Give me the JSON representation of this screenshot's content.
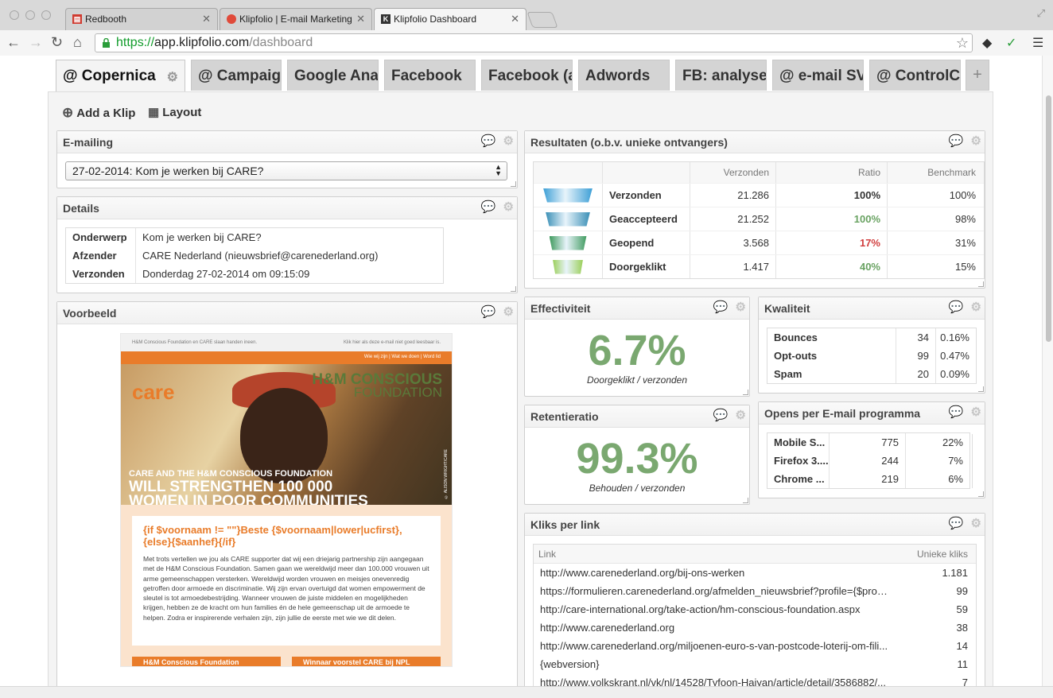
{
  "browser": {
    "tabs": [
      {
        "title": "Redbooth"
      },
      {
        "title": "Klipfolio | E-mail Marketing"
      },
      {
        "title": "Klipfolio Dashboard"
      }
    ],
    "url_scheme": "https://",
    "url_host": "app.klipfolio.com",
    "url_path": "/dashboard"
  },
  "dashboard": {
    "tabs": [
      {
        "label": "@ Copernica"
      },
      {
        "label": "@ Campaign"
      },
      {
        "label": "Google Analytics"
      },
      {
        "label": "Facebook"
      },
      {
        "label": "Facebook (a"
      },
      {
        "label": "Adwords"
      },
      {
        "label": "FB: analyse"
      },
      {
        "label": "@ e-mail SV"
      },
      {
        "label": "@ ControlC"
      }
    ],
    "plus": "+",
    "add_klip": "Add a Klip",
    "layout": "Layout"
  },
  "emailing": {
    "title": "E-mailing",
    "selected": "27-02-2014: Kom je werken bij CARE?"
  },
  "details": {
    "title": "Details",
    "rows": [
      {
        "label": "Onderwerp",
        "value": "Kom je werken bij CARE?"
      },
      {
        "label": "Afzender",
        "value": "CARE Nederland (nieuwsbrief@carenederland.org)"
      },
      {
        "label": "Verzonden",
        "value": "Donderdag 27-02-2014 om 09:15:09"
      }
    ]
  },
  "voorbeeld": {
    "title": "Voorbeeld",
    "top_left": "H&M Conscious Foundation en CARE slaan handen ineen.",
    "top_right": "Klik hier als deze e-mail niet goed leesbaar is.",
    "nav": "Wie wij zijn | Wat we doen | Word lid",
    "logo_care": "care",
    "logo_hm": "H&M CONSCIOUS",
    "logo_hm2": "FOUNDATION",
    "hero_line1": "CARE AND THE H&M CONSCIOUS FOUNDATION",
    "hero_line2": "WILL STRENGTHEN 100 000",
    "hero_line3": "WOMEN IN POOR COMMUNITIES",
    "credit": "© ALISON WRIGHT/CARE",
    "greeting": "{if $voornaam != \"\"}Beste {$voornaam|lower|ucfirst}, {else}{$aanhef}{/if}",
    "body": "Met trots vertellen we jou als CARE supporter dat wij een driejarig partnership zijn aangegaan met de H&M Conscious Foundation. Samen gaan we wereldwijd meer dan 100.000 vrouwen uit arme gemeenschappen versterken. Wereldwijd worden vrouwen en meisjes onevenredig getroffen door armoede en discriminatie. Wij zijn ervan overtuigd dat women empowerment de sleutel is tot armoedebestrijding. Wanneer vrouwen de juiste middelen en mogelijkheden krijgen, hebben ze de kracht om hun families én de hele gemeenschap uit de armoede te helpen. Zodra er inspirerende verhalen zijn, zijn jullie de eerste met wie we dit delen.",
    "btn1": "H&M Conscious Foundation",
    "btn2": "Winnaar voorstel CARE bij NPL"
  },
  "resultaten": {
    "title": "Resultaten (o.b.v. unieke ontvangers)",
    "headers": [
      "Verzonden",
      "Ratio",
      "Benchmark"
    ],
    "rows": [
      {
        "label": "Verzonden",
        "value": "21.286",
        "ratio": "100%",
        "benchmark": "100%",
        "ratio_color": "#333333",
        "funnel": "#3d9fd6",
        "funnel_pct": 100
      },
      {
        "label": "Geaccepteerd",
        "value": "21.252",
        "ratio": "100%",
        "benchmark": "98%",
        "ratio_color": "#6aa363",
        "funnel": "#3a8fb6",
        "funnel_pct": 90
      },
      {
        "label": "Geopend",
        "value": "3.568",
        "ratio": "17%",
        "benchmark": "31%",
        "ratio_color": "#d13f3f",
        "funnel": "#3f9a5e",
        "funnel_pct": 75
      },
      {
        "label": "Doorgeklikt",
        "value": "1.417",
        "ratio": "40%",
        "benchmark": "15%",
        "ratio_color": "#6aa363",
        "funnel": "#9bcf5a",
        "funnel_pct": 62
      }
    ]
  },
  "effectiviteit": {
    "title": "Effectiviteit",
    "value": "6.7%",
    "sub": "Doorgeklikt / verzonden"
  },
  "retentie": {
    "title": "Retentieratio",
    "value": "99.3%",
    "sub": "Behouden / verzonden"
  },
  "kwaliteit": {
    "title": "Kwaliteit",
    "rows": [
      {
        "label": "Bounces",
        "count": "34",
        "pct": "0.16%"
      },
      {
        "label": "Opt-outs",
        "count": "99",
        "pct": "0.47%"
      },
      {
        "label": "Spam",
        "count": "20",
        "pct": "0.09%"
      }
    ]
  },
  "opens": {
    "title": "Opens per E-mail programma",
    "rows": [
      {
        "label": "Mobile S...",
        "count": "775",
        "pct": "22%"
      },
      {
        "label": "Firefox 3....",
        "count": "244",
        "pct": "7%"
      },
      {
        "label": "Chrome ...",
        "count": "219",
        "pct": "6%"
      }
    ]
  },
  "kliks": {
    "title": "Kliks per link",
    "headers": [
      "Link",
      "Unieke kliks"
    ],
    "rows": [
      {
        "link": "http://www.carenederland.org/bij-ons-werken",
        "count": "1.181"
      },
      {
        "link": "https://formulieren.carenederland.org/afmelden_nieuwsbrief?profile={$prof...",
        "count": "99"
      },
      {
        "link": "http://care-international.org/take-action/hm-conscious-foundation.aspx",
        "count": "59"
      },
      {
        "link": "http://www.carenederland.org",
        "count": "38"
      },
      {
        "link": "http://www.carenederland.org/miljoenen-euro-s-van-postcode-loterij-om-fili...",
        "count": "14"
      },
      {
        "link": "{webversion}",
        "count": "11"
      },
      {
        "link": "http://www.volkskrant.nl/vk/nl/14528/Tyfoon-Haiyan/article/detail/3586882/...",
        "count": "7"
      }
    ]
  },
  "icons": {
    "comment": "comment-icon",
    "gear": "gear-icon",
    "plus_circle": "add-circle-icon",
    "grid": "layout-grid-icon"
  }
}
